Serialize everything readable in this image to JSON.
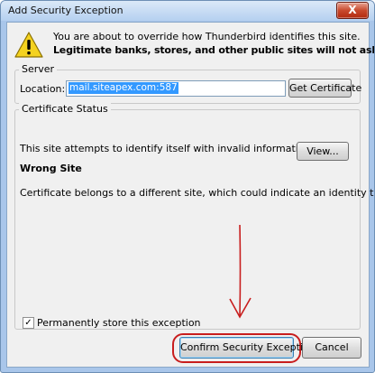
{
  "window": {
    "title": "Add Security Exception",
    "close_glyph": "X"
  },
  "message": {
    "line1": "You are about to override how Thunderbird identifies this site.",
    "line2": "Legitimate banks, stores, and other public sites will not ask you to do this.",
    "icon": "warning-icon"
  },
  "server": {
    "group_label": "Server",
    "location_label": "Location:",
    "location_value": "mail.siteapex.com:587",
    "get_certificate": "Get Certificate"
  },
  "certificate_status": {
    "group_label": "Certificate Status",
    "status_text": "This site attempts to identify itself with invalid information.",
    "view_button": "View...",
    "problem_title": "Wrong Site",
    "problem_detail": "Certificate belongs to a different site, which could indicate an identity theft."
  },
  "permanent_store": {
    "label": "Permanently store this exception",
    "checked": true
  },
  "buttons": {
    "confirm": "Confirm Security Exception",
    "cancel": "Cancel"
  },
  "colors": {
    "annotation_red": "#c81e1e",
    "selection_blue": "#3399ff"
  }
}
